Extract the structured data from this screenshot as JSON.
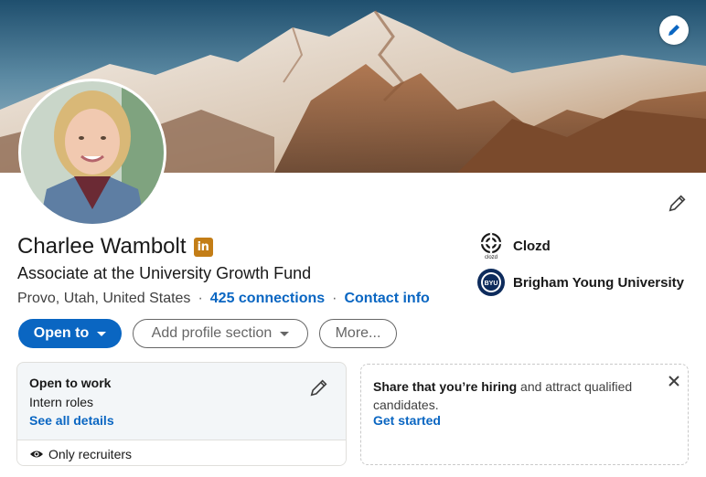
{
  "profile": {
    "name": "Charlee Wambolt",
    "headline": "Associate at the University Growth Fund",
    "location": "Provo, Utah, United States",
    "separator": "·",
    "connections": "425 connections",
    "contact_info": "Contact info",
    "badge_text": "in"
  },
  "orgs": [
    {
      "label": "Clozd",
      "logo_text": "clozd"
    },
    {
      "label": "Brigham Young University",
      "logo_text": "BYU"
    }
  ],
  "actions": {
    "open_to": "Open to",
    "add_section": "Add profile section",
    "more": "More..."
  },
  "open_to_work": {
    "title": "Open to work",
    "roles": "Intern roles",
    "details_link": "See all details",
    "visibility": "Only recruiters"
  },
  "hiring": {
    "bold": "Share that you’re hiring",
    "rest": " and attract qualified candidates.",
    "cta": "Get started"
  },
  "colors": {
    "brand_blue": "#0a66c2",
    "badge_gold": "#c37d16",
    "card_bg": "#f3f6f8"
  },
  "icons": {
    "banner_edit": "pencil-icon",
    "intro_edit": "pencil-icon",
    "visibility": "eye-icon",
    "close": "close-icon"
  }
}
